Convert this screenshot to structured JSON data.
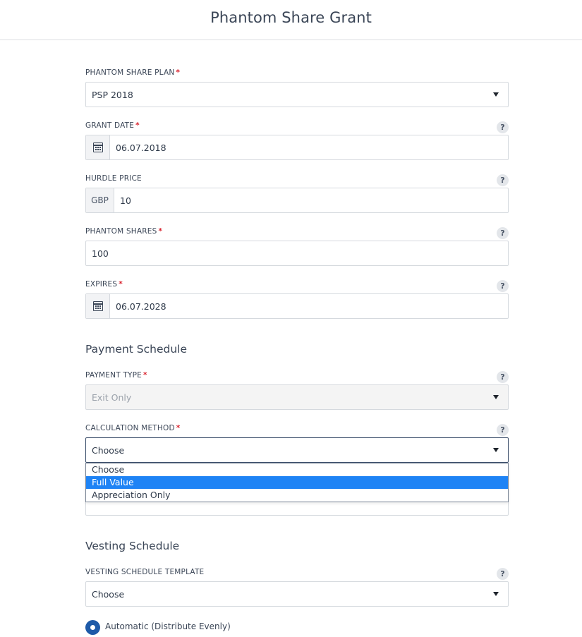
{
  "page": {
    "title": "Phantom Share Grant"
  },
  "fields": {
    "plan": {
      "label": "PHANTOM SHARE PLAN",
      "required_mark": "*",
      "value": "PSP 2018"
    },
    "grant_date": {
      "label": "GRANT DATE",
      "required_mark": "*",
      "value": "06.07.2018",
      "help": "?"
    },
    "hurdle_price": {
      "label": "HURDLE PRICE",
      "currency": "GBP",
      "value": "10",
      "help": "?"
    },
    "phantom_shares": {
      "label": "PHANTOM SHARES",
      "required_mark": "*",
      "value": "100",
      "help": "?"
    },
    "expires": {
      "label": "EXPIRES",
      "required_mark": "*",
      "value": "06.07.2028",
      "help": "?"
    }
  },
  "payment_schedule": {
    "heading": "Payment Schedule",
    "payment_type": {
      "label": "PAYMENT TYPE",
      "required_mark": "*",
      "value": "Exit Only",
      "help": "?"
    },
    "calculation_method": {
      "label": "CALCULATION METHOD",
      "required_mark": "*",
      "value": "Choose",
      "help": "?",
      "options": [
        "Choose",
        "Full Value",
        "Appreciation Only"
      ],
      "highlighted": "Full Value"
    }
  },
  "vesting_schedule": {
    "heading": "Vesting Schedule",
    "template": {
      "label": "VESTING SCHEDULE TEMPLATE",
      "value": "Choose",
      "help": "?"
    },
    "radio_automatic": {
      "label": "Automatic (Distribute Evenly)",
      "checked": true
    }
  },
  "colors": {
    "accent": "#1e83f5",
    "required": "#d9232e",
    "radio": "#1e5aa8"
  }
}
